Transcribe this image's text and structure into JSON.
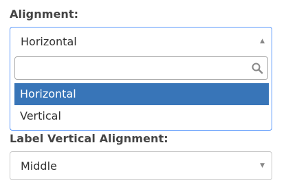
{
  "alignment": {
    "label": "Alignment:",
    "selected": "Horizontal",
    "arrow_icon": "arrow-up-icon",
    "dropdown": {
      "search_value": "",
      "search_icon": "magnifier-icon",
      "options": [
        "Horizontal",
        "Vertical"
      ],
      "highlighted_index": 0
    }
  },
  "label_vertical_alignment": {
    "label": "Label Vertical Alignment:",
    "selected": "Middle",
    "arrow_icon": "arrow-down-icon"
  },
  "colors": {
    "focus_border": "#5897fb",
    "highlight_bg": "#3875b8",
    "highlight_text": "#ffffff"
  }
}
